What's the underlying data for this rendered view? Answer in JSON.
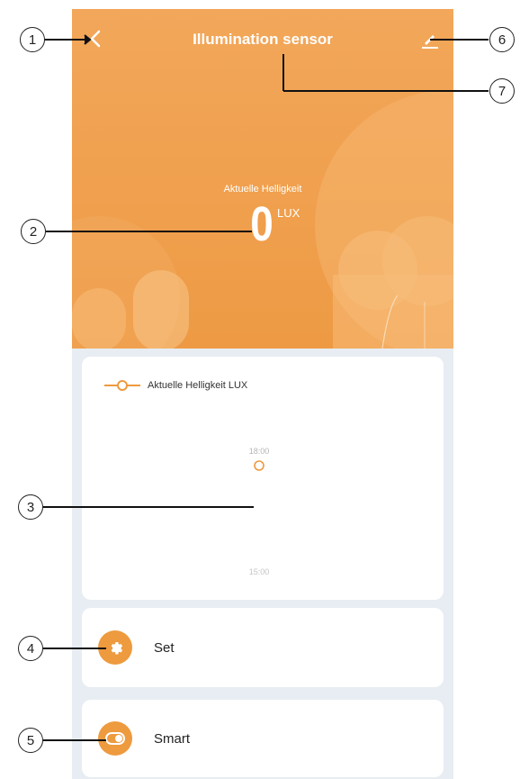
{
  "header": {
    "title": "Illumination sensor",
    "back_icon": "chevron-left-icon",
    "edit_icon": "edit-pencil-icon"
  },
  "reading": {
    "label": "Aktuelle Helligkeit",
    "value": "0",
    "unit": "LUX"
  },
  "chart": {
    "legend": "Aktuelle Helligkeit LUX",
    "point_label": "18:00",
    "bottom_label": "15:00"
  },
  "actions": {
    "set_label": "Set",
    "set_icon": "gear-icon",
    "smart_label": "Smart",
    "smart_icon": "toggle-icon"
  },
  "callouts": [
    "1",
    "2",
    "3",
    "4",
    "5",
    "6",
    "7"
  ],
  "colors": {
    "accent": "#ee9a3e",
    "hero_top": "#f2a75a",
    "background": "#e7edf2"
  }
}
